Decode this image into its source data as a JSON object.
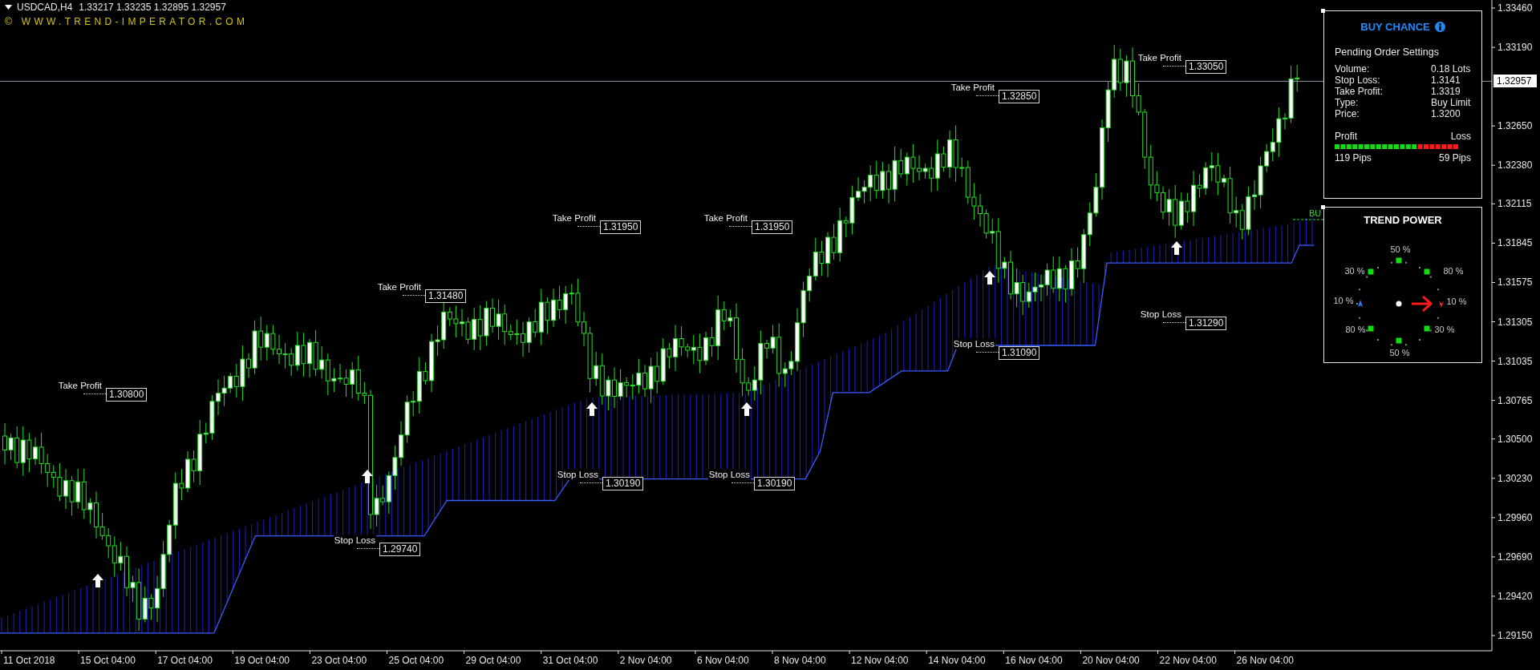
{
  "symbol_bar": {
    "title": "USDCAD,H4",
    "prices": "1.33217 1.33235 1.32895 1.32957"
  },
  "copyright": "© WWW.TREND-IMPERATOR.COM",
  "price_axis": {
    "labels": [
      "1.33460",
      "1.33190",
      "1.32650",
      "1.32380",
      "1.32115",
      "1.31845",
      "1.31575",
      "1.31305",
      "1.31035",
      "1.30765",
      "1.30500",
      "1.30230",
      "1.29960",
      "1.29690",
      "1.29420",
      "1.29150"
    ],
    "current_price": "1.32957"
  },
  "time_axis": {
    "labels": [
      "11 Oct 2018",
      "15 Oct 04:00",
      "17 Oct 04:00",
      "19 Oct 04:00",
      "23 Oct 04:00",
      "25 Oct 04:00",
      "29 Oct 04:00",
      "31 Oct 04:00",
      "2 Nov 04:00",
      "6 Nov 04:00",
      "8 Nov 04:00",
      "12 Nov 04:00",
      "14 Nov 04:00",
      "16 Nov 04:00",
      "20 Nov 04:00",
      "22 Nov 04:00",
      "26 Nov 04:00"
    ]
  },
  "orders": [
    {
      "label": "Take Profit",
      "price": "1.30800"
    },
    {
      "label": "Take Profit",
      "price": "1.31480"
    },
    {
      "label": "Take Profit",
      "price": "1.31950"
    },
    {
      "label": "Take Profit",
      "price": "1.31950"
    },
    {
      "label": "Take Profit",
      "price": "1.32850"
    },
    {
      "label": "Take Profit",
      "price": "1.33050"
    },
    {
      "label": "Stop Loss",
      "price": "1.29740"
    },
    {
      "label": "Stop Loss",
      "price": "1.30190"
    },
    {
      "label": "Stop Loss",
      "price": "1.30190"
    },
    {
      "label": "Stop Loss",
      "price": "1.31090"
    },
    {
      "label": "Stop Loss",
      "price": "1.31290"
    }
  ],
  "pending_marker": "BU",
  "buy_chance": {
    "title": "BUY CHANCE",
    "subtitle": "Pending Order Settings",
    "rows": [
      {
        "label": "Volume:",
        "value": "0.18 Lots"
      },
      {
        "label": "Stop Loss:",
        "value": "1.3141"
      },
      {
        "label": "Take Profit:",
        "value": "1.3319"
      },
      {
        "label": "Type:",
        "value": "Buy Limit"
      },
      {
        "label": "Price:",
        "value": "1.3200"
      }
    ],
    "meter": {
      "left_label": "Profit",
      "right_label": "Loss",
      "level": 0.67,
      "left_value": "119 Pips",
      "right_value": "59 Pips"
    }
  },
  "trend_power": {
    "title": "TREND POWER",
    "labels": [
      "50 %",
      "80 %",
      "10 %",
      "30 %",
      "50 %",
      "80 %",
      "10 %",
      "30 %"
    ]
  }
}
